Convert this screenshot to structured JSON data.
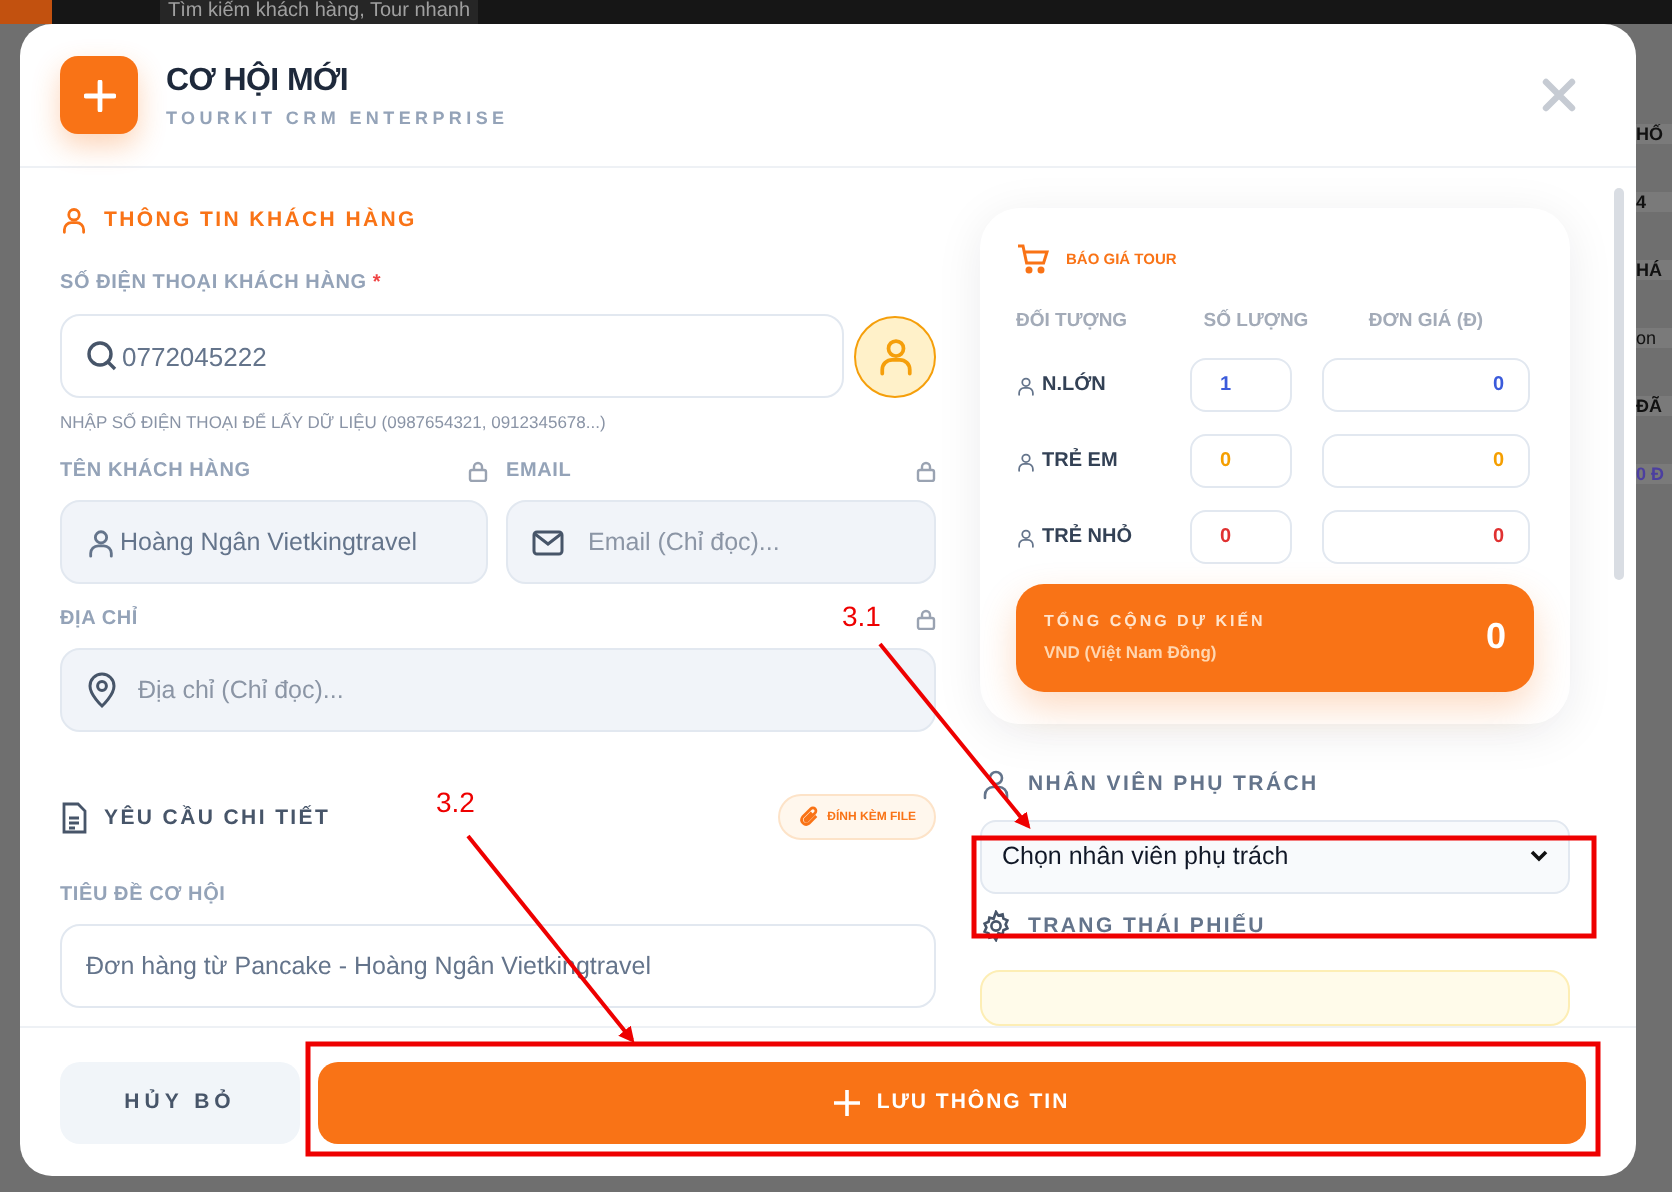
{
  "backdrop": {
    "search_placeholder": "Tìm kiếm khách hàng, Tour nhanh",
    "side_texts": [
      {
        "text": "HỐ",
        "kind": "bold"
      },
      {
        "text": "4",
        "kind": "bold"
      },
      {
        "text": "HÁ",
        "kind": "bold"
      },
      {
        "text": "on",
        "kind": "plain"
      },
      {
        "text": "ĐÃ",
        "kind": "bold"
      },
      {
        "text": "0 Đ",
        "kind": "money"
      }
    ]
  },
  "modal": {
    "title": "CƠ HỘI MỚI",
    "subtitle": "TOURKIT CRM ENTERPRISE"
  },
  "customer": {
    "heading": "THÔNG TIN KHÁCH HÀNG",
    "phone_label": "SỐ ĐIỆN THOẠI KHÁCH HÀNG",
    "required_mark": "*",
    "phone_value": "0772045222",
    "phone_hint": "NHẬP SỐ ĐIỆN THOẠI ĐỂ LẤY DỮ LIỆU (0987654321, 0912345678...)",
    "name_label": "TÊN KHÁCH HÀNG",
    "name_value": "Hoàng Ngân Vietkingtravel",
    "name_locked": true,
    "email_label": "EMAIL",
    "email_placeholder": "Email (Chỉ đọc)...",
    "email_locked": true,
    "address_label": "ĐỊA CHỈ",
    "address_placeholder": "Địa chỉ (Chỉ đọc)...",
    "address_locked": true
  },
  "details": {
    "heading": "YÊU CẦU CHI TIẾT",
    "attach_button": "ĐÍNH KÈM FILE",
    "title_label": "TIÊU ĐỀ CƠ HỘI",
    "title_value": "Đơn hàng từ Pancake - Hoàng Ngân Vietkingtravel"
  },
  "quote": {
    "heading": "BÁO GIÁ TOUR",
    "columns": [
      "ĐỐI TƯỢNG",
      "SỐ LƯỢNG",
      "ĐƠN GIÁ (Đ)"
    ],
    "rows": [
      {
        "label": "N.LỚN",
        "quantity": "1",
        "price": "0",
        "color": "#3b5bdb"
      },
      {
        "label": "TRẺ EM",
        "quantity": "0",
        "price": "0",
        "color": "#f59f00"
      },
      {
        "label": "TRẺ NHỎ",
        "quantity": "0",
        "price": "0",
        "color": "#e03131"
      }
    ],
    "total_label": "TỔNG CỘNG DỰ KIẾN",
    "currency": "VND (Việt Nam Đồng)",
    "total": "0"
  },
  "staff": {
    "heading": "NHÂN VIÊN PHỤ TRÁCH",
    "select_value": "Chọn nhân viên phụ trách"
  },
  "status": {
    "heading": "TRẠNG THÁI PHIẾU"
  },
  "footer": {
    "cancel": "HỦY BỎ",
    "save": "LƯU THÔNG TIN"
  },
  "annotations": [
    {
      "label": "3.1"
    },
    {
      "label": "3.2"
    }
  ]
}
